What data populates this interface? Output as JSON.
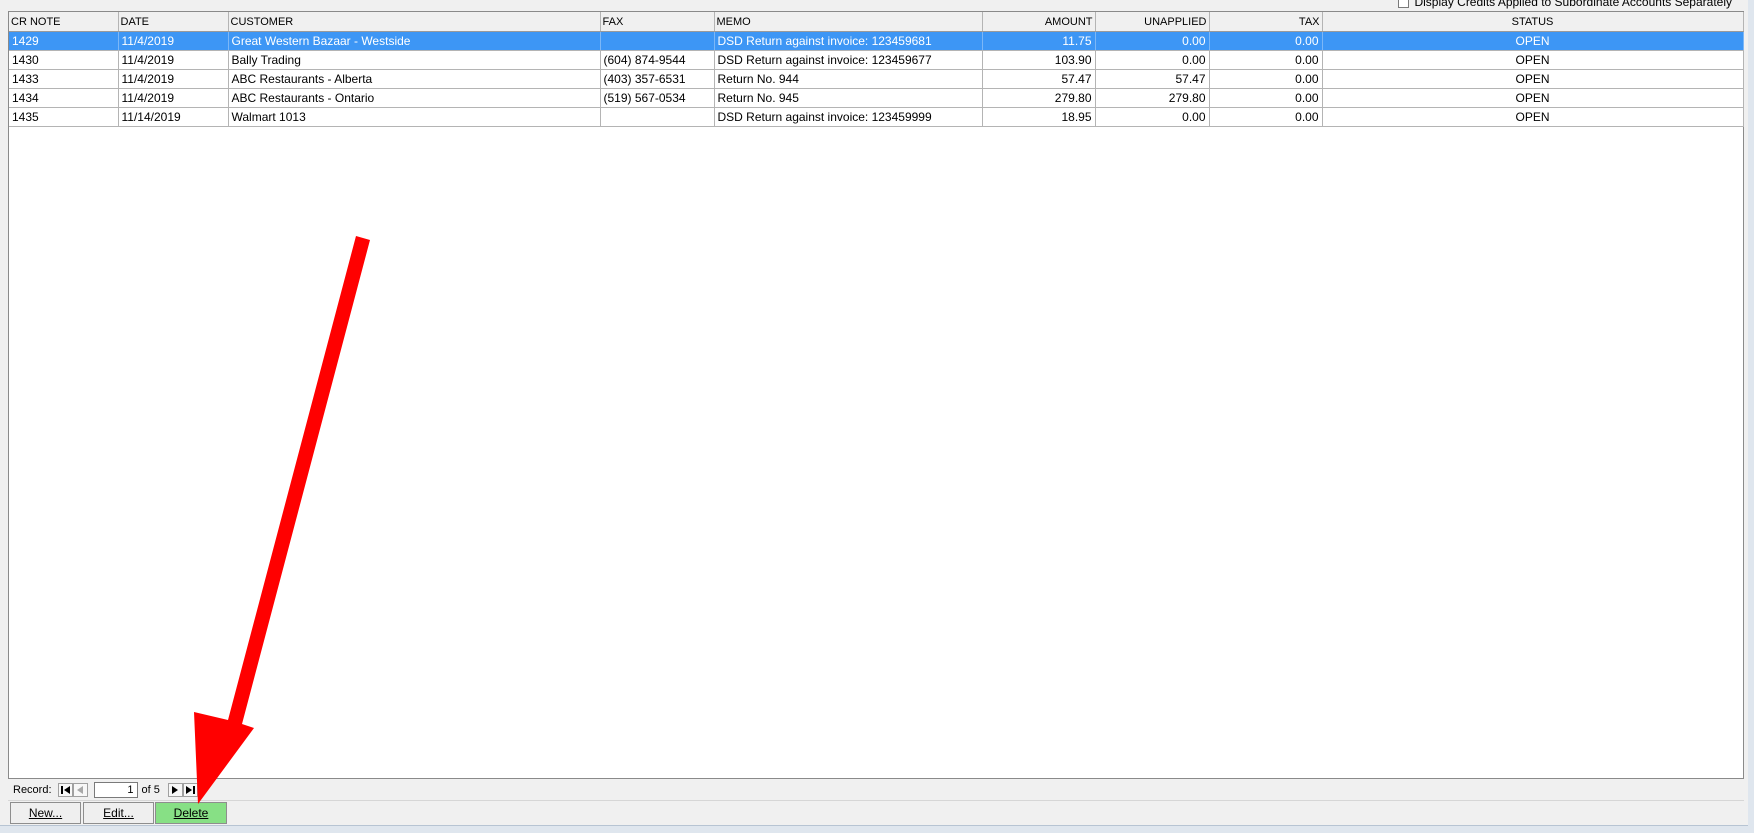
{
  "options": {
    "subaccounts_label": "Display Credits Applied to Subordinate Accounts Separately",
    "subaccounts_checked": false
  },
  "grid": {
    "columns": [
      "CR NOTE",
      "DATE",
      "CUSTOMER",
      "FAX",
      "MEMO",
      "AMOUNT",
      "UNAPPLIED",
      "TAX",
      "STATUS"
    ],
    "rows": [
      [
        "1429",
        "11/4/2019",
        "Great Western Bazaar - Westside",
        "",
        "DSD Return against invoice: 123459681",
        "11.75",
        "0.00",
        "0.00",
        "OPEN"
      ],
      [
        "1430",
        "11/4/2019",
        "Bally Trading",
        "(604) 874-9544",
        "DSD Return against invoice: 123459677",
        "103.90",
        "0.00",
        "0.00",
        "OPEN"
      ],
      [
        "1433",
        "11/4/2019",
        "ABC Restaurants - Alberta",
        "(403) 357-6531",
        "Return No. 944",
        "57.47",
        "57.47",
        "0.00",
        "OPEN"
      ],
      [
        "1434",
        "11/4/2019",
        "ABC Restaurants - Ontario",
        "(519) 567-0534",
        "Return No. 945",
        "279.80",
        "279.80",
        "0.00",
        "OPEN"
      ],
      [
        "1435",
        "11/14/2019",
        "Walmart 1013",
        "",
        "DSD Return against invoice: 123459999",
        "18.95",
        "0.00",
        "0.00",
        "OPEN"
      ]
    ],
    "selected_row": 0
  },
  "record_nav": {
    "label": "Record:",
    "current": "1",
    "of_text": "of 5"
  },
  "buttons": {
    "new": "New...",
    "edit": "Edit...",
    "delete": "Delete"
  },
  "colors": {
    "selection": "#3d96f5",
    "delete_highlight": "#87e085",
    "arrow": "#ff0000"
  }
}
